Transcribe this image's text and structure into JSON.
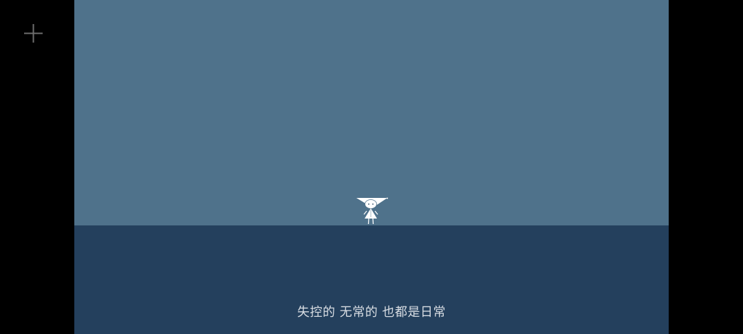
{
  "colors": {
    "letterbox": "#000000",
    "sky": "#4f728b",
    "ground": "#24405d",
    "character": "#ffffff",
    "subtitle_text": "#d8dde3",
    "crosshair": "#6f6f6f"
  },
  "hud": {
    "crosshair_icon": "crosshair-icon"
  },
  "scene": {
    "character_icon": "hooded-figure-icon",
    "subtitle": "失控的 无常的 也都是日常"
  }
}
